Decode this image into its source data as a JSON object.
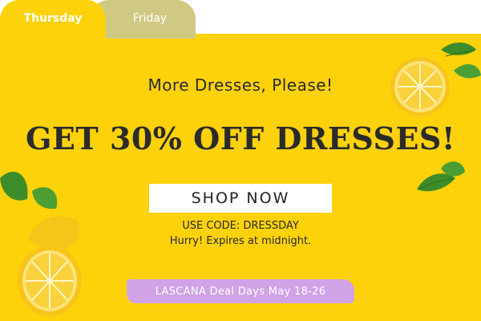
{
  "tabs": [
    {
      "label": "Thursday",
      "active": true
    },
    {
      "label": "Friday",
      "active": false
    }
  ],
  "promo": {
    "subtitle": "More Dresses, Please!",
    "headline": "GET 30% OFF DRESSES!",
    "cta_label": "SHOP NOW",
    "code_text": "USE CODE: DRESSDAY",
    "expiry_text": "Hurry! Expires at midnight.",
    "deal_text": "LASCANA Deal Days May 18-26"
  },
  "colors": {
    "banner_bg": "#fdd20a",
    "tab_inactive": "#cfc984",
    "deal_strip": "#cfa3e6",
    "text_dark": "#2b2b2b"
  },
  "icons": [
    "lemon-half-icon",
    "lemon-leaf-icon",
    "lemon-slice-icon",
    "lemon-peel-icon"
  ]
}
